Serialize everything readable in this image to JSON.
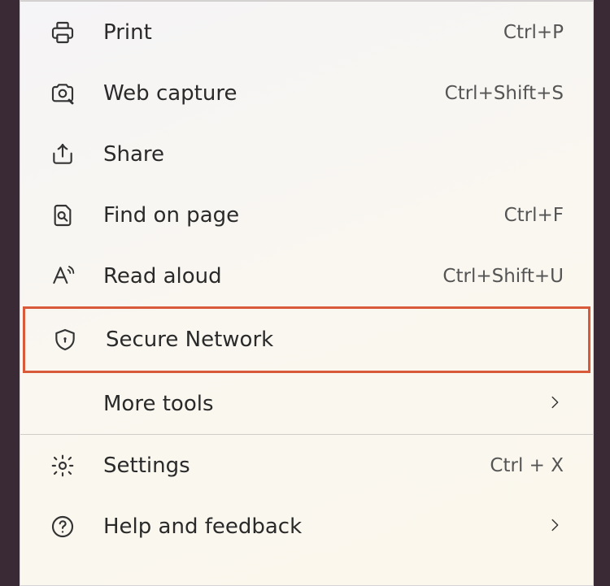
{
  "menu": {
    "items": [
      {
        "label": "Print",
        "shortcut": "Ctrl+P"
      },
      {
        "label": "Web capture",
        "shortcut": "Ctrl+Shift+S"
      },
      {
        "label": "Share",
        "shortcut": ""
      },
      {
        "label": "Find on page",
        "shortcut": "Ctrl+F"
      },
      {
        "label": "Read aloud",
        "shortcut": "Ctrl+Shift+U"
      },
      {
        "label": "Secure Network",
        "shortcut": ""
      },
      {
        "label": "More tools",
        "shortcut": ""
      },
      {
        "label": "Settings",
        "shortcut": "Ctrl + X"
      },
      {
        "label": "Help and feedback",
        "shortcut": ""
      }
    ]
  }
}
